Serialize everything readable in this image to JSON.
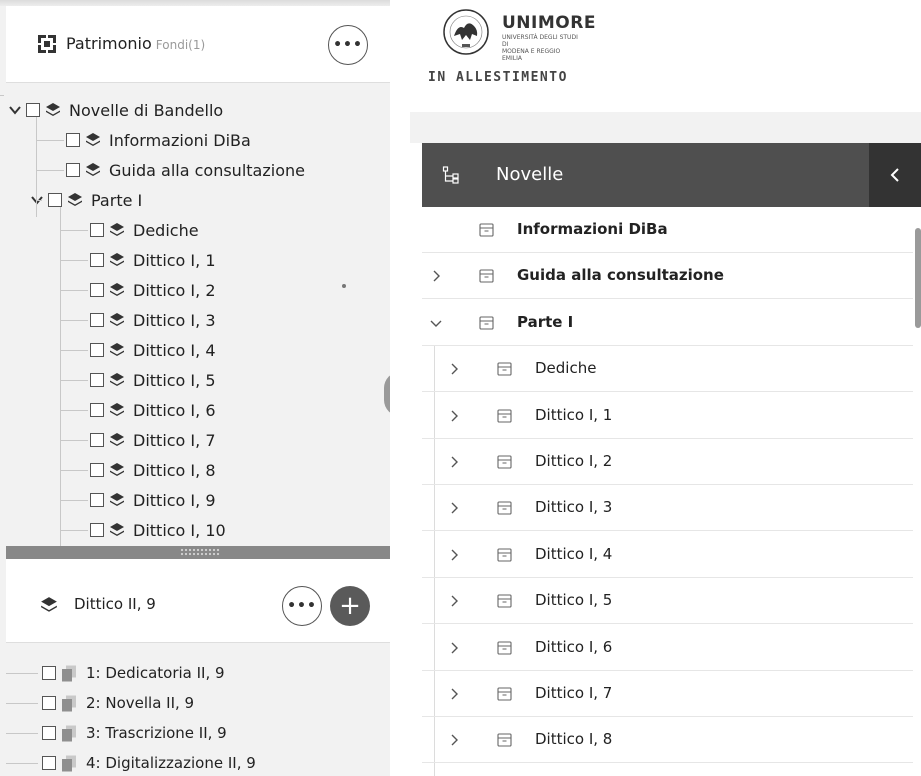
{
  "fondi_panel": {
    "title": "Patrimonio",
    "subtitle": "Fondi(1)",
    "more_label": "•••",
    "tree": [
      {
        "label": "Novelle di Bandello",
        "level": 0,
        "expanded": true
      },
      {
        "label": "Informazioni DiBa",
        "level": 1
      },
      {
        "label": "Guida alla consultazione",
        "level": 1
      },
      {
        "label": "Parte I",
        "level": 1,
        "expanded": true
      },
      {
        "label": "Dediche",
        "level": 2
      },
      {
        "label": "Dittico I, 1",
        "level": 2
      },
      {
        "label": "Dittico I, 2",
        "level": 2
      },
      {
        "label": "Dittico I, 3",
        "level": 2
      },
      {
        "label": "Dittico I, 4",
        "level": 2
      },
      {
        "label": "Dittico I, 5",
        "level": 2
      },
      {
        "label": "Dittico I, 6",
        "level": 2
      },
      {
        "label": "Dittico I, 7",
        "level": 2
      },
      {
        "label": "Dittico I, 8",
        "level": 2
      },
      {
        "label": "Dittico I, 9",
        "level": 2
      },
      {
        "label": "Dittico I, 10",
        "level": 2
      }
    ]
  },
  "node_panel": {
    "title": "Dittico II, 9",
    "more_label": "•••",
    "add_label": "+",
    "items": [
      {
        "label": "1: Dedicatoria II, 9"
      },
      {
        "label": "2: Novella II, 9"
      },
      {
        "label": "3: Trascrizione II, 9"
      },
      {
        "label": "4: Digitalizzazione II, 9"
      }
    ]
  },
  "brand": {
    "name": "UNIMORE",
    "sub_line1": "UNIVERSITÀ DEGLI STUDI DI",
    "sub_line2": "MODENA E REGGIO EMILIA",
    "tagline": "IN ALLESTIMENTO"
  },
  "navigator": {
    "title": "Novelle",
    "collapse_label": "‹",
    "items": [
      {
        "label": "Informazioni DiBa",
        "bold": true,
        "caret": "none",
        "indent": 0
      },
      {
        "label": "Guida alla consultazione",
        "bold": true,
        "caret": "right",
        "indent": 0
      },
      {
        "label": "Parte I",
        "bold": true,
        "caret": "down",
        "indent": 0
      },
      {
        "label": "Dediche",
        "caret": "right",
        "indent": 1
      },
      {
        "label": "Dittico I, 1",
        "caret": "right",
        "indent": 1
      },
      {
        "label": "Dittico I, 2",
        "caret": "right",
        "indent": 1
      },
      {
        "label": "Dittico I, 3",
        "caret": "right",
        "indent": 1
      },
      {
        "label": "Dittico I, 4",
        "caret": "right",
        "indent": 1
      },
      {
        "label": "Dittico I, 5",
        "caret": "right",
        "indent": 1
      },
      {
        "label": "Dittico I, 6",
        "caret": "right",
        "indent": 1
      },
      {
        "label": "Dittico I, 7",
        "caret": "right",
        "indent": 1
      },
      {
        "label": "Dittico I, 8",
        "caret": "right",
        "indent": 1
      }
    ]
  },
  "colors": {
    "nav_header": "#4f4f4f",
    "nav_collapse": "#333333",
    "panel_bg": "#f2f2f2",
    "splitter": "#888888"
  }
}
